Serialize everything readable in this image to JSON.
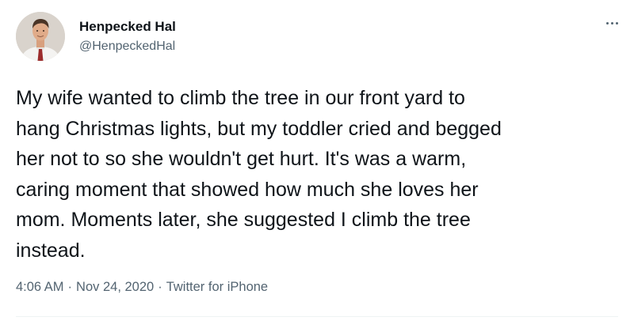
{
  "author": {
    "display_name": "Henpecked Hal",
    "handle": "@HenpeckedHal",
    "avatar_icon": "profile-photo"
  },
  "tweet": {
    "lines": [
      "My wife wanted to climb the tree in our front yard to",
      "hang Christmas lights, but my toddler cried and begged",
      "her not to so she wouldn't get hurt. It's was a warm,",
      "caring moment that showed how much she loves her",
      "mom. Moments later, she suggested I climb the tree",
      "instead."
    ]
  },
  "meta": {
    "time": "4:06 AM",
    "separator": "·",
    "date": "Nov 24, 2020",
    "source": "Twitter for iPhone"
  },
  "menu": {
    "icon": "more-horizontal-icon"
  },
  "colors": {
    "text_primary": "#0f1419",
    "text_secondary": "#536471",
    "divider": "#eff3f4"
  }
}
